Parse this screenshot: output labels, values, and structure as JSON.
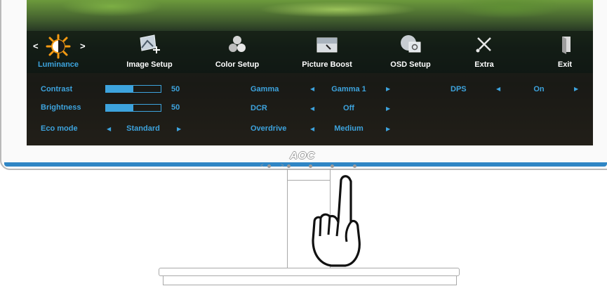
{
  "menu": {
    "items": [
      {
        "label": "Luminance",
        "icon": "sun-contrast-icon",
        "active": true
      },
      {
        "label": "Image Setup",
        "icon": "image-setup-icon"
      },
      {
        "label": "Color Setup",
        "icon": "color-setup-icon"
      },
      {
        "label": "Picture Boost",
        "icon": "picture-boost-icon"
      },
      {
        "label": "OSD Setup",
        "icon": "osd-setup-icon"
      },
      {
        "label": "Extra",
        "icon": "extra-tools-icon"
      },
      {
        "label": "Exit",
        "icon": "exit-door-icon"
      }
    ],
    "prev_arrow": "<",
    "next_arrow": ">"
  },
  "luminance": {
    "contrast": {
      "label": "Contrast",
      "value": "50",
      "level": 0.5
    },
    "brightness": {
      "label": "Brightness",
      "value": "50",
      "level": 0.5
    },
    "eco_mode": {
      "label": "Eco mode",
      "value": "Standard"
    },
    "gamma": {
      "label": "Gamma",
      "value": "Gamma 1"
    },
    "dcr": {
      "label": "DCR",
      "value": "Off"
    },
    "overdrive": {
      "label": "Overdrive",
      "value": "Medium"
    },
    "dps": {
      "label": "DPS",
      "value": "On"
    }
  },
  "monitor": {
    "brand": "AOC",
    "button_labels": [
      "<",
      ">",
      "",
      "",
      ""
    ]
  },
  "colors": {
    "accent": "#3da3dd",
    "bezel_stripe": "#2f86c5"
  }
}
